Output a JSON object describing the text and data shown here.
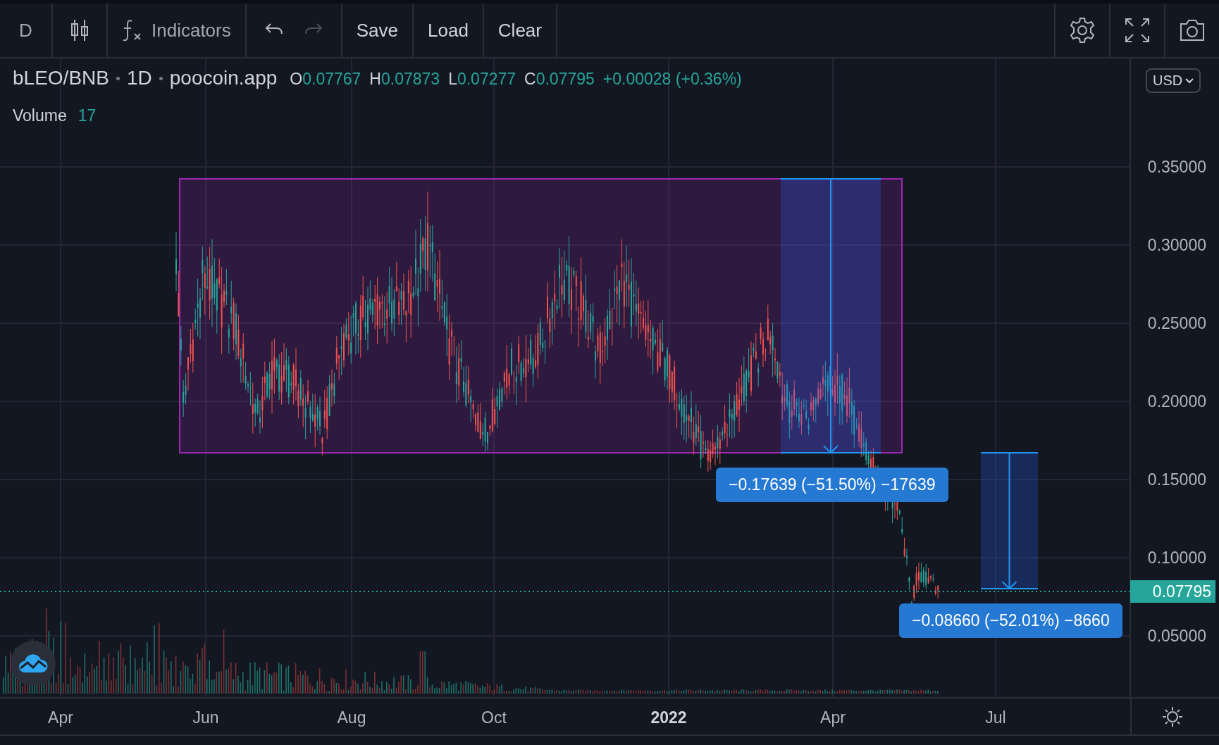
{
  "toolbar": {
    "interval": "D",
    "indicators": "Indicators",
    "history": [
      {
        "kind": "undo",
        "disabled": false
      },
      {
        "kind": "redo",
        "disabled": true
      }
    ],
    "buttons": [
      "Save",
      "Load",
      "Clear"
    ]
  },
  "legend": {
    "symbol": "bLEO/BNB",
    "interval": "1D",
    "source": "poocoin.app",
    "ohlc": [
      {
        "key": "O",
        "value": "0.07767"
      },
      {
        "key": "H",
        "value": "0.07873"
      },
      {
        "key": "L",
        "value": "0.07277"
      },
      {
        "key": "C",
        "value": "0.07795"
      }
    ],
    "change": "+0.00028 (+0.36%)"
  },
  "volume": {
    "label": "Volume",
    "value": "17"
  },
  "currency": "USD",
  "price_axis": [
    "0.35000",
    "0.30000",
    "0.25000",
    "0.20000",
    "0.15000",
    "0.10000",
    "0.05000"
  ],
  "current_price": "0.07795",
  "measures": [
    {
      "label": "−0.17639 (−51.50%) −17639"
    },
    {
      "label": "−0.08660 (−52.01%) −8660"
    }
  ],
  "time_axis": [
    {
      "label": "Apr",
      "kind": "month"
    },
    {
      "label": "Jun",
      "kind": "month"
    },
    {
      "label": "Aug",
      "kind": "month"
    },
    {
      "label": "Oct",
      "kind": "month"
    },
    {
      "label": "2022",
      "kind": "year"
    },
    {
      "label": "Apr",
      "kind": "month"
    },
    {
      "label": "Jul",
      "kind": "month"
    }
  ]
}
